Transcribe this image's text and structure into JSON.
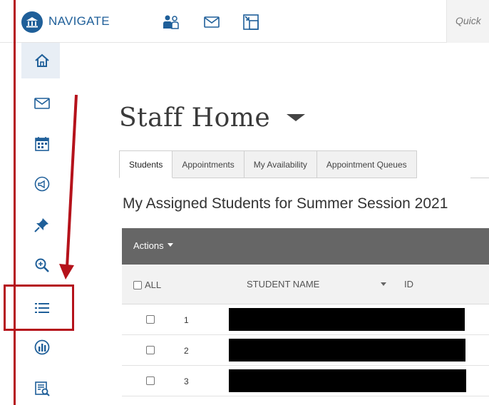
{
  "app": {
    "name": "NAVIGATE"
  },
  "topbar": {
    "icons": [
      "people-icon",
      "mail-icon",
      "window-icon"
    ],
    "quick_search_text": "Quick"
  },
  "sidebar": {
    "items": [
      {
        "icon": "home-icon",
        "active": true
      },
      {
        "icon": "mail-icon",
        "active": false
      },
      {
        "icon": "calendar-icon",
        "active": false
      },
      {
        "icon": "megaphone-icon",
        "active": false
      },
      {
        "icon": "pin-icon",
        "active": false
      },
      {
        "icon": "search-zoom-icon",
        "active": false
      },
      {
        "icon": "list-icon",
        "active": false
      },
      {
        "icon": "analytics-icon",
        "active": false
      },
      {
        "icon": "report-search-icon",
        "active": false
      }
    ]
  },
  "page": {
    "title": "Staff Home",
    "tabs": [
      {
        "label": "Students",
        "active": true
      },
      {
        "label": "Appointments",
        "active": false
      },
      {
        "label": "My Availability",
        "active": false
      },
      {
        "label": "Appointment Queues",
        "active": false
      }
    ],
    "section_title": "My Assigned Students for Summer Session 2021"
  },
  "table": {
    "actions_label": "Actions",
    "select_all_label": "ALL",
    "columns": {
      "name": "STUDENT NAME",
      "id": "ID"
    },
    "rows": [
      {
        "num": "1",
        "name_redacted": true
      },
      {
        "num": "2",
        "name_redacted": true
      },
      {
        "num": "3",
        "name_redacted": true
      }
    ]
  },
  "annotation": {
    "color": "#b5121b"
  },
  "colors": {
    "brand": "#1f5f99",
    "actions_bar": "#666666"
  }
}
